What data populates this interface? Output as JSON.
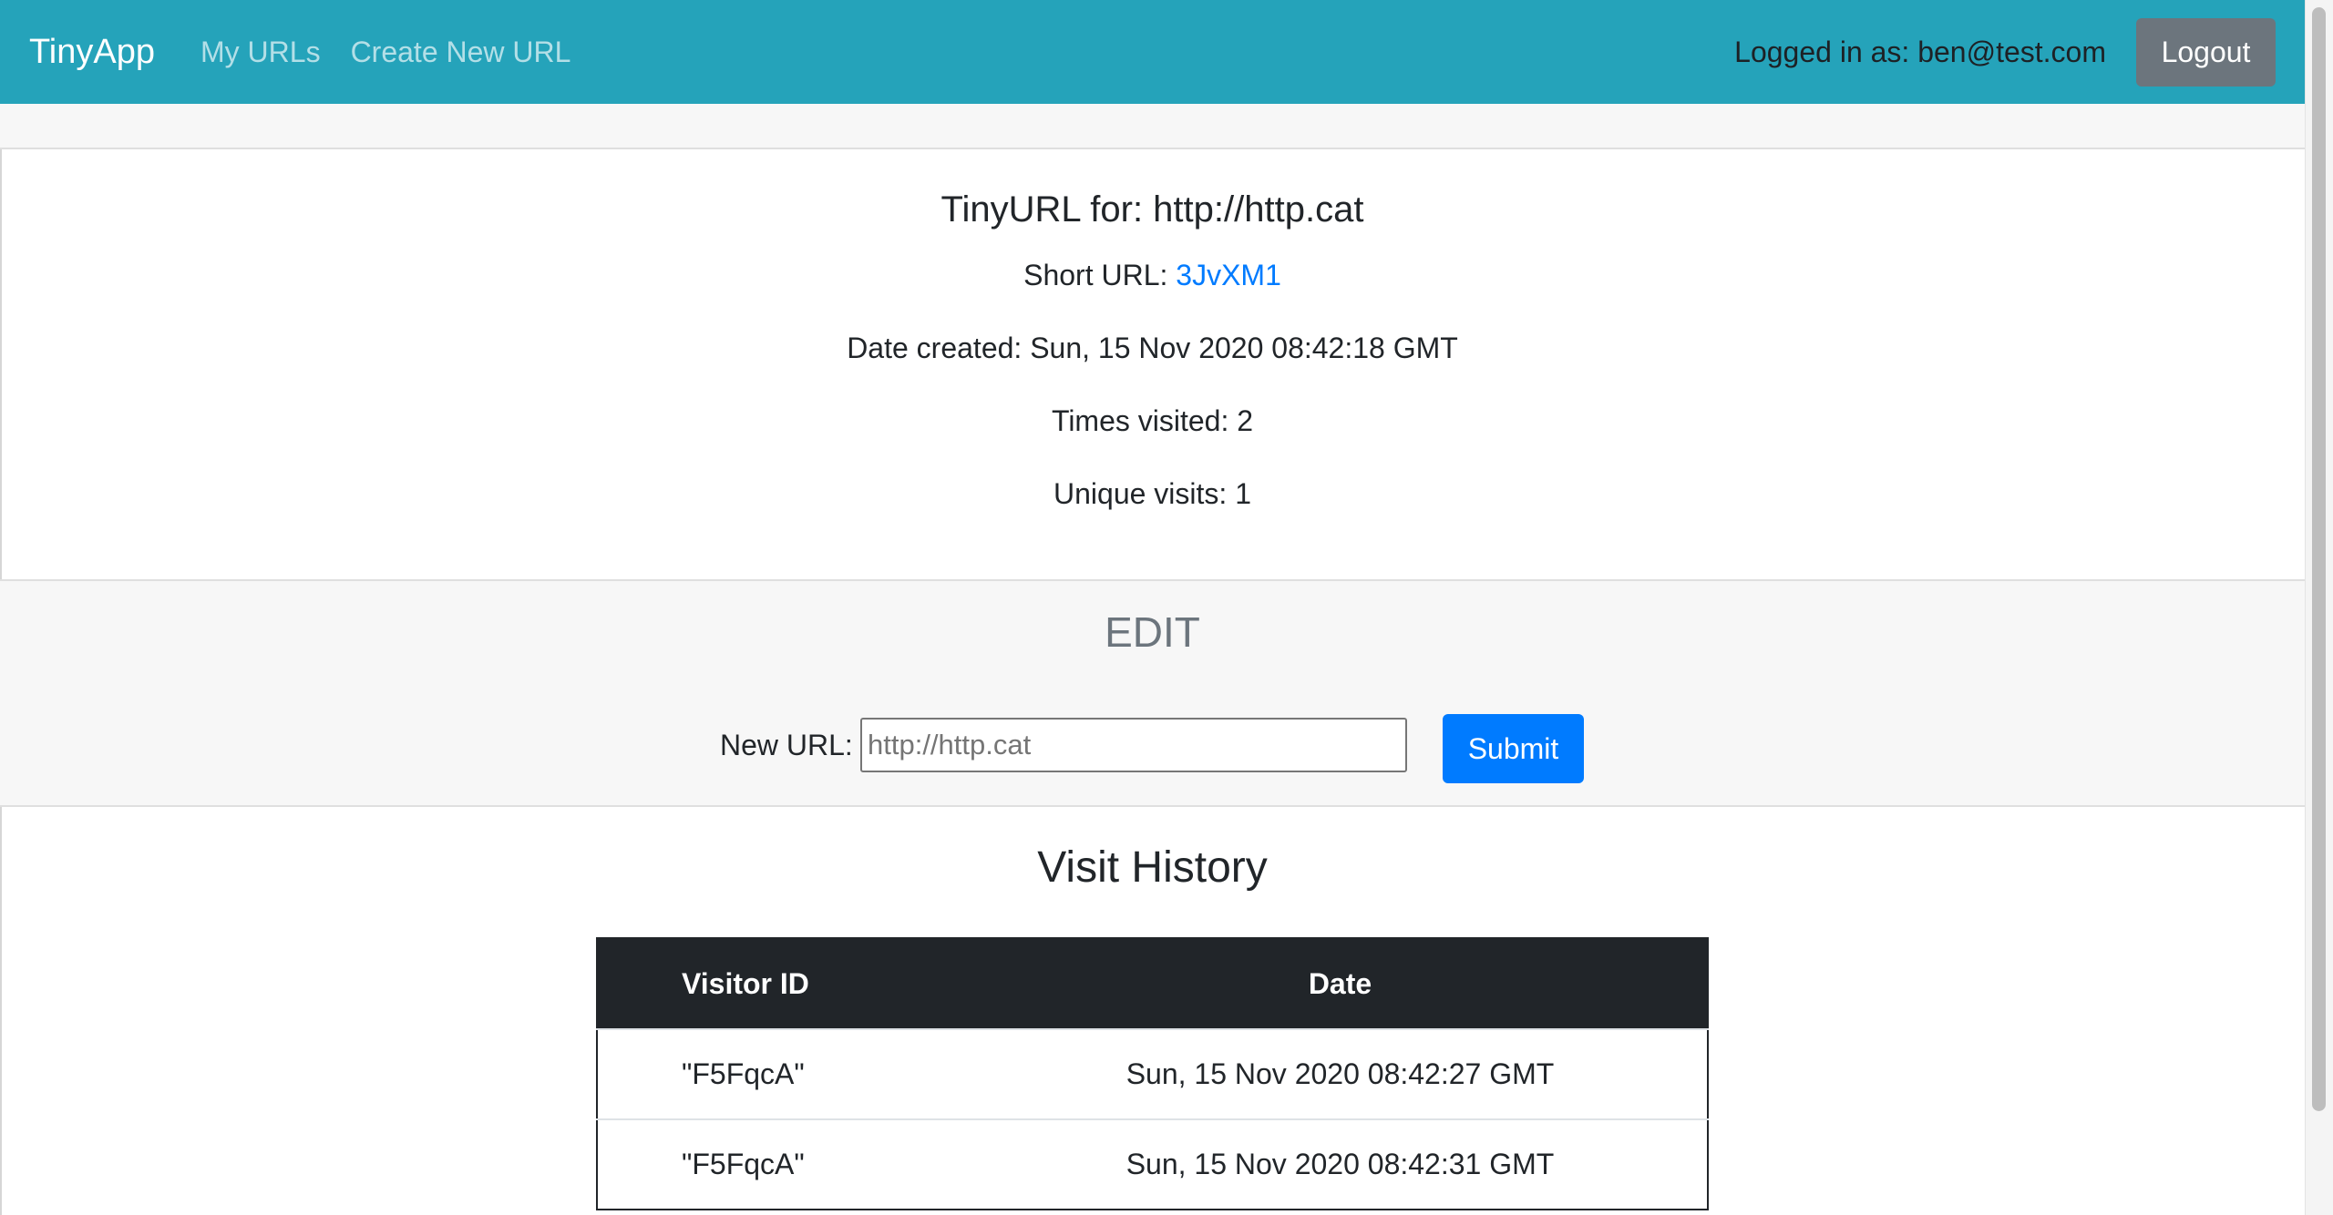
{
  "navbar": {
    "brand": "TinyApp",
    "links": [
      "My URLs",
      "Create New URL"
    ],
    "logged_in_text": "Logged in as: ben@test.com",
    "logout_label": "Logout"
  },
  "info": {
    "title": "TinyURL for: http://http.cat",
    "short_url_label": "Short URL: ",
    "short_url_value": "3JvXM1",
    "date_created": "Date created: Sun, 15 Nov 2020 08:42:18 GMT",
    "times_visited": "Times visited: 2",
    "unique_visits": "Unique visits: 1"
  },
  "edit": {
    "title": "EDIT",
    "label": "New URL:",
    "input_placeholder": "http://http.cat",
    "submit_label": "Submit"
  },
  "history": {
    "title": "Visit History",
    "columns": [
      "Visitor ID",
      "Date"
    ],
    "rows": [
      {
        "visitor_id": "\"F5FqcA\"",
        "date": "Sun, 15 Nov 2020 08:42:27 GMT"
      },
      {
        "visitor_id": "\"F5FqcA\"",
        "date": "Sun, 15 Nov 2020 08:42:31 GMT"
      }
    ]
  },
  "colors": {
    "navbar_bg": "#25a3ba",
    "link_blue": "#007bff",
    "dark": "#212529",
    "secondary": "#6c757d"
  }
}
